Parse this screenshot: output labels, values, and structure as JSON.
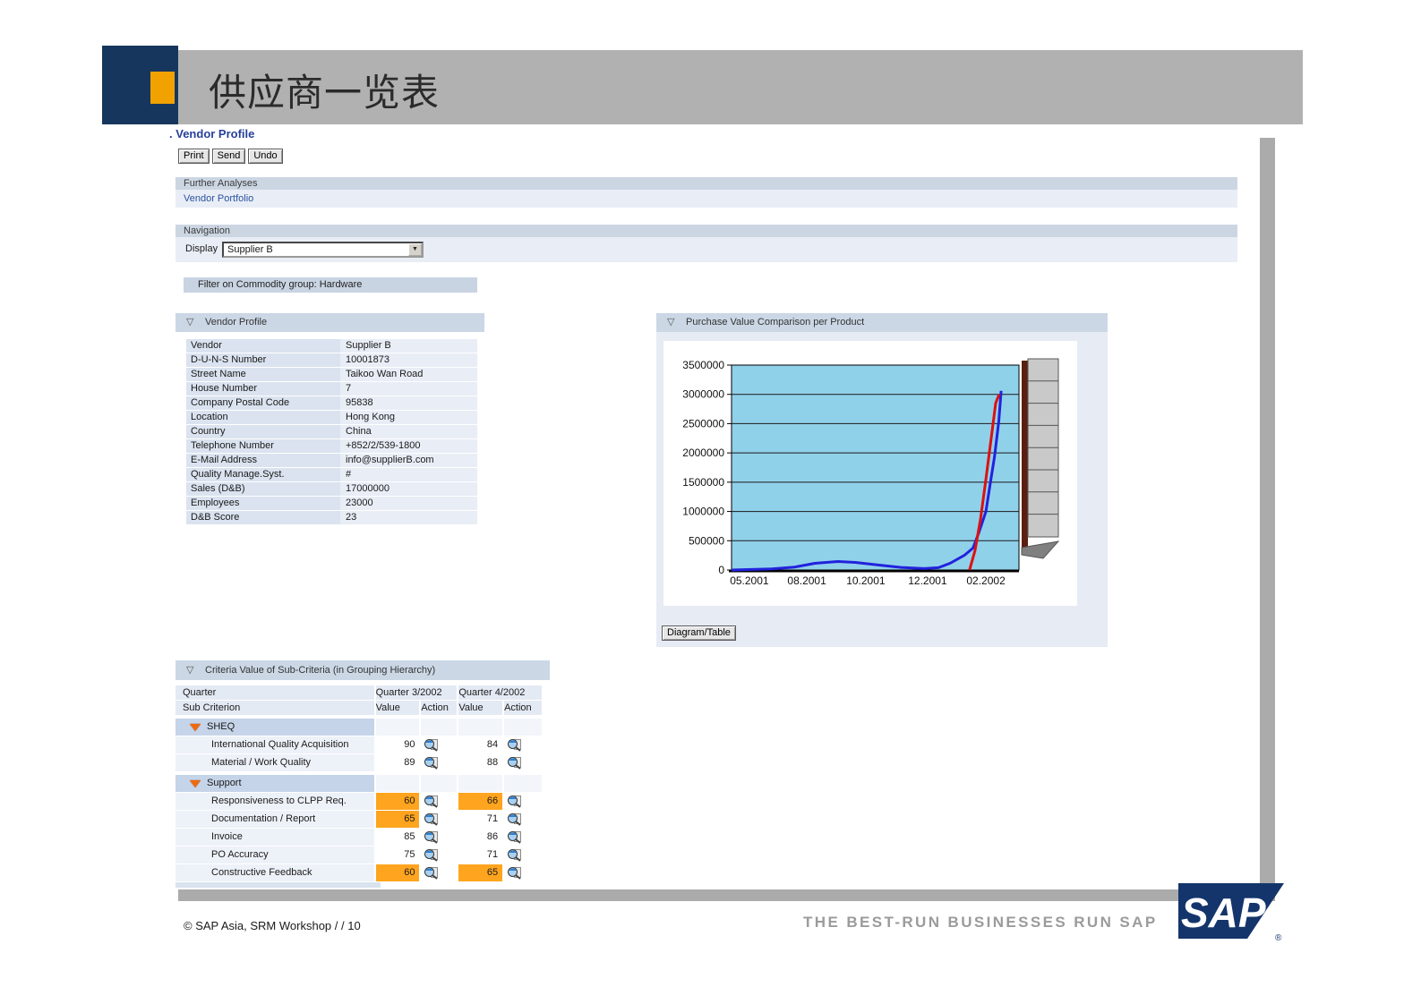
{
  "slide": {
    "title": "供应商一览表"
  },
  "app": {
    "page_title_prefix": ".",
    "page_title": "Vendor Profile",
    "toolbar": {
      "print": "Print",
      "send": "Send",
      "undo": "Undo"
    },
    "further_analyses": {
      "header": "Further Analyses",
      "link": "Vendor Portfolio"
    },
    "navigation": {
      "header": "Navigation",
      "display_label": "Display",
      "display_value": "Supplier B"
    },
    "filter_bar": "Filter on Commodity group: Hardware",
    "vendor_profile": {
      "header": "Vendor Profile",
      "rows": [
        {
          "label": "Vendor",
          "value": "Supplier B"
        },
        {
          "label": "D-U-N-S Number",
          "value": "10001873"
        },
        {
          "label": "Street Name",
          "value": "Taikoo Wan Road"
        },
        {
          "label": "House Number",
          "value": "7"
        },
        {
          "label": "Company Postal Code",
          "value": "95838"
        },
        {
          "label": "Location",
          "value": "Hong Kong"
        },
        {
          "label": "Country",
          "value": "China"
        },
        {
          "label": "Telephone Number",
          "value": "+852/2/539-1800"
        },
        {
          "label": "E-Mail Address",
          "value": "info@supplierB.com"
        },
        {
          "label": "Quality Manage.Syst.",
          "value": "#"
        },
        {
          "label": "Sales (D&B)",
          "value": "17000000"
        },
        {
          "label": "Employees",
          "value": "23000"
        },
        {
          "label": "D&B Score",
          "value": "23"
        }
      ]
    },
    "purchase_chart": {
      "header": "Purchase Value Comparison per Product",
      "button": "Diagram/Table"
    },
    "criteria": {
      "header": "Criteria Value of Sub-Criteria (in Grouping Hierarchy)",
      "col_quarter": "Quarter",
      "col_sub_criterion": "Sub Criterion",
      "q3_header": "Quarter 3/2002",
      "q4_header": "Quarter 4/2002",
      "value_label": "Value",
      "action_label": "Action",
      "groups": [
        {
          "name": "SHEQ",
          "rows": [
            {
              "label": "International Quality Acquisition",
              "q3": "90",
              "q3_alert": false,
              "q4": "84",
              "q4_alert": false
            },
            {
              "label": "Material / Work Quality",
              "q3": "89",
              "q3_alert": false,
              "q4": "88",
              "q4_alert": false
            }
          ]
        },
        {
          "name": "Support",
          "rows": [
            {
              "label": "Responsiveness to CLPP Req.",
              "q3": "60",
              "q3_alert": true,
              "q4": "66",
              "q4_alert": true
            },
            {
              "label": "Documentation / Report",
              "q3": "65",
              "q3_alert": true,
              "q4": "71",
              "q4_alert": false
            },
            {
              "label": "Invoice",
              "q3": "85",
              "q3_alert": false,
              "q4": "86",
              "q4_alert": false
            },
            {
              "label": "PO Accuracy",
              "q3": "75",
              "q3_alert": false,
              "q4": "71",
              "q4_alert": false
            },
            {
              "label": "Constructive Feedback",
              "q3": "60",
              "q3_alert": true,
              "q4": "65",
              "q4_alert": true
            }
          ]
        }
      ]
    }
  },
  "chart_data": {
    "type": "line",
    "title": "Purchase Value Comparison per Product",
    "xlabel": "",
    "ylabel": "",
    "ylim": [
      0,
      3500000
    ],
    "ytick_step": 500000,
    "grid": true,
    "legend": "none",
    "x_tick_labels": [
      "05.2001",
      "08.2001",
      "10.2001",
      "12.2001",
      "02.2002"
    ],
    "x_tick_fractions": [
      0.062,
      0.262,
      0.467,
      0.682,
      0.885
    ],
    "series": [
      {
        "name": "product-blue",
        "color": "#2222dd",
        "points": [
          [
            0.0,
            0
          ],
          [
            0.14,
            20000
          ],
          [
            0.22,
            50000
          ],
          [
            0.29,
            115000
          ],
          [
            0.37,
            145000
          ],
          [
            0.43,
            130000
          ],
          [
            0.51,
            85000
          ],
          [
            0.59,
            45000
          ],
          [
            0.67,
            25000
          ],
          [
            0.72,
            40000
          ],
          [
            0.76,
            115000
          ],
          [
            0.81,
            250000
          ],
          [
            0.84,
            375000
          ],
          [
            0.86,
            635000
          ],
          [
            0.885,
            1000000
          ],
          [
            0.9,
            1475000
          ],
          [
            0.915,
            1935000
          ],
          [
            0.93,
            2545000
          ],
          [
            0.938,
            3060000
          ]
        ]
      },
      {
        "name": "product-red",
        "color": "#dd1111",
        "points": [
          [
            0.828,
            0
          ],
          [
            0.847,
            330000
          ],
          [
            0.866,
            865000
          ],
          [
            0.885,
            1550000
          ],
          [
            0.903,
            2240000
          ],
          [
            0.919,
            2850000
          ],
          [
            0.931,
            3000000
          ]
        ]
      }
    ]
  },
  "icons": {
    "dropdown_arrow": "▼",
    "section_collapse": "▽"
  },
  "colors": {
    "navy": "#17365d",
    "accent_orange": "#f2a200",
    "banner_gray": "#b1b1b1",
    "bar_blue": "#ccd6e3",
    "row_blue": "#e9edf5",
    "link_blue": "#2a52a0",
    "alert_orange": "#ffa41e",
    "plot_cyan": "#90d1ea"
  },
  "footer": {
    "copyright": "©   SAP Asia,  SRM Workshop /  / 10",
    "tagline": "THE BEST-RUN BUSINESSES RUN SAP",
    "logo_text": "SAP",
    "logo_mark": "®"
  }
}
